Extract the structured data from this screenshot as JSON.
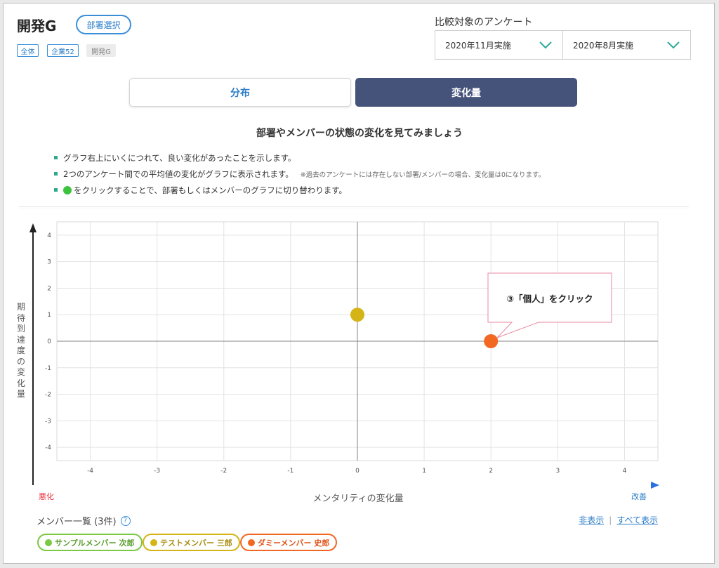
{
  "header": {
    "title": "開発G",
    "dept_select_label": "部署選択",
    "breadcrumbs": [
      "全体",
      "企業52",
      "開発G"
    ]
  },
  "compare": {
    "label": "比較対象のアンケート",
    "survey_a": "2020年11月実施",
    "survey_b": "2020年8月実施"
  },
  "tabs": [
    {
      "label": "分布",
      "active": false
    },
    {
      "label": "変化量",
      "active": true
    }
  ],
  "intro": {
    "heading": "部署やメンバーの状態の変化を見てみましょう",
    "bullet1": "グラフ右上にいくにつれて、良い変化があったことを示します。",
    "bullet2": "2つのアンケート間での平均値の変化がグラフに表示されます。",
    "bullet2_note": "※過去のアンケートには存在しない部署/メンバーの場合、変化量は0になります。",
    "bullet3": "をクリックすることで、部署もしくはメンバーのグラフに切り替わります。"
  },
  "chart_data": {
    "type": "scatter",
    "xlabel": "メンタリティの変化量",
    "ylabel": "期待到達度の変化量",
    "xlim": [
      -4.5,
      4.5
    ],
    "ylim": [
      -4.5,
      4.5
    ],
    "x_ticks": [
      "-4",
      "-3",
      "-2",
      "-1",
      "0",
      "1",
      "2",
      "3",
      "4"
    ],
    "y_ticks": [
      "4",
      "3",
      "2",
      "1",
      "0",
      "-1",
      "-2",
      "-3",
      "-4"
    ],
    "grid": true,
    "x_axis_left_label": "悪化",
    "x_axis_right_label": "改善",
    "points": [
      {
        "x": 0,
        "y": 1,
        "color": "#d4b416"
      },
      {
        "x": 2,
        "y": 0,
        "color": "#f26722"
      }
    ],
    "annotation": "③「個人」をクリック"
  },
  "members": {
    "title": "メンバー一覧 (3件)",
    "help_icon": "?",
    "hide_label": "非表示",
    "show_all_label": "すべて表示",
    "chips": [
      {
        "label": "サンプルメンバー 次郎",
        "color": "#7ac943"
      },
      {
        "label": "テストメンバー 三郎",
        "color": "#d4b416"
      },
      {
        "label": "ダミーメンバー 史郎",
        "color": "#f26722"
      }
    ]
  }
}
